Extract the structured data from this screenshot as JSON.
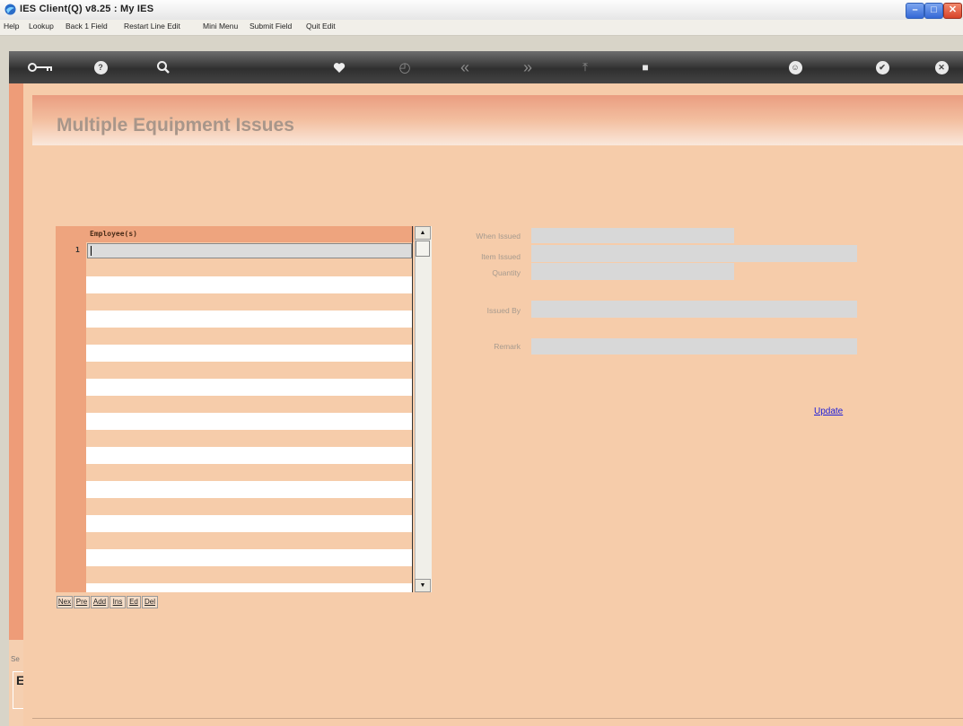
{
  "window": {
    "title": "IES Client(Q) v8.25 : My IES",
    "minimize_glyph": "–",
    "maximize_glyph": "□",
    "close_glyph": "✕"
  },
  "menu": {
    "items": [
      "Help",
      "Lookup",
      "Back 1 Field",
      "Restart Line Edit",
      "Mini Menu",
      "Submit Field",
      "Quit Edit"
    ]
  },
  "toolbar": {
    "icons": [
      "key-icon",
      "help-icon",
      "search-icon",
      "heart-icon",
      "clock-icon",
      "rewind-icon",
      "fast-forward-icon",
      "first-icon",
      "stop-icon",
      "ok-icon",
      "check-icon",
      "close-icon"
    ],
    "help_glyph": "?",
    "clock_glyph": "◴",
    "rewind_glyph": "«",
    "forward_glyph": "»",
    "first_glyph": "⤒",
    "stop_glyph": "■",
    "ok_glyph": "☺",
    "check_glyph": "✔",
    "close_glyph": "✕"
  },
  "page": {
    "title": "Multiple Equipment Issues"
  },
  "grid": {
    "header": "Employee(s)",
    "row_number": "1",
    "buttons": [
      "Nex",
      "Pre",
      "Add",
      "Ins",
      "Ed",
      "Del"
    ],
    "scroll_up": "▲",
    "scroll_down": "▼"
  },
  "form": {
    "when_issued_label": "When Issued",
    "item_issued_label": "Item Issued",
    "quantity_label": "Quantity",
    "issued_by_label": "Issued By",
    "remark_label": "Remark",
    "update_link": "Update"
  },
  "status": {
    "fragment": "Se",
    "glyph": "E"
  },
  "colors": {
    "background": "#f6ccaa",
    "grid_header": "#eea47e",
    "field": "#d8d8d8",
    "link": "#1c1cd8"
  }
}
